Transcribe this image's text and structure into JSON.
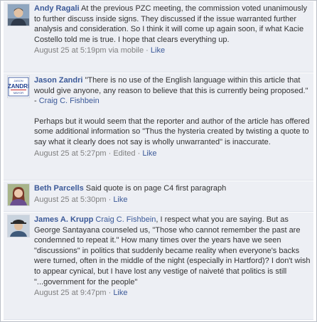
{
  "comments": [
    {
      "author": "Andy Ragali",
      "avatar_icon": "profile-photo-man-icon",
      "text": "At the previous PZC meeting, the commission voted unanimously to further discuss inside signs. They discussed if the issue warranted further analysis and consideration. So I think it will come up again soon, if what Kacie Costello told me is true. I hope that clears everything up.",
      "timestamp": "August 25 at 5:19pm via mobile",
      "separator": "·",
      "like": "Like"
    },
    {
      "author": "Jason Zandri",
      "avatar_icon": "campaign-sign-icon",
      "avatar_text": {
        "top": "JASON",
        "name": "ZANDRI",
        "bottom": "MAYOR"
      },
      "text_1": "\"There is no use of the English language within this article that would give anyone, any reason to believe that this is currently being proposed.\" - ",
      "quote_link": "Craig C. Fishbein",
      "text_2": "Perhaps but it would seem that the reporter and author of the article has offered some additional information so \"Thus the hysteria created by twisting a quote to say what it clearly does not say is wholly unwarranted\" is inaccurate.",
      "timestamp": "August 25 at 5:27pm",
      "edited": "Edited",
      "separator": "·",
      "like": "Like"
    },
    {
      "author": "Beth Parcells",
      "avatar_icon": "profile-photo-woman-icon",
      "text": "Said quote is on page C4 first paragraph",
      "timestamp": "August 25 at 5:30pm",
      "separator": "·",
      "like": "Like"
    },
    {
      "author": "James A. Krupp",
      "avatar_icon": "profile-photo-man-hat-icon",
      "mention": "Craig C. Fishbein",
      "text": ", I respect what you are saying. But as George Santayana counseled us, \"Those who cannot remember the past are condemned to repeat it.\" How many times over the years have we seen \"discussions\" in politics that suddenly became reality when everyone's backs were turned, often in the middle of the night (especially in Hartford)? I don't wish to appear cynical, but I have lost any vestige of naiveté that politics is still \"...government for the people\"",
      "timestamp": "August 25 at 9:47pm",
      "separator": "·",
      "like": "Like"
    }
  ],
  "colors": {
    "link": "#3b5998",
    "comment_bg": "#edeff4",
    "meta_text": "#7f7f7f",
    "body_text": "#333333"
  }
}
